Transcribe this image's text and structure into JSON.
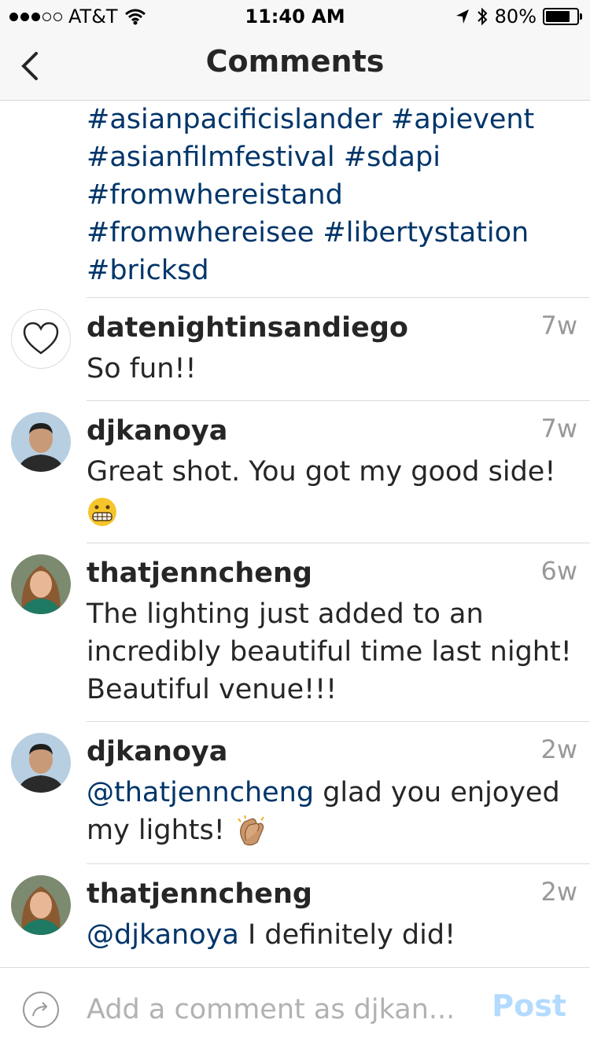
{
  "status_bar": {
    "carrier": "AT&T",
    "time": "11:40 AM",
    "battery": "80%",
    "battery_level": 0.8
  },
  "nav": {
    "title": "Comments"
  },
  "caption": {
    "lines": [
      "#asianpacificislander #apievent",
      "#asianfilmfestival #sdapi",
      "#fromwhereistand",
      "#fromwhereisee #libertystation",
      "#bricksd"
    ]
  },
  "comments": [
    {
      "user": "datenightinsandiego",
      "time": "7w",
      "text": "So fun!!"
    },
    {
      "user": "djkanoya",
      "time": "7w",
      "text": "Great shot. You got my good side!"
    },
    {
      "user": "thatjenncheng",
      "time": "6w",
      "text": "The lighting just added to an incredibly beautiful time last night! Beautiful venue!!!"
    },
    {
      "user": "djkanoya",
      "time": "2w",
      "mention": "@thatjenncheng",
      "text": " glad you enjoyed my lights! "
    },
    {
      "user": "thatjenncheng",
      "time": "2w",
      "mention": "@djkanoya",
      "text": " I definitely did!"
    }
  ],
  "compose": {
    "placeholder": "Add a comment as djkan...",
    "post_label": "Post"
  }
}
